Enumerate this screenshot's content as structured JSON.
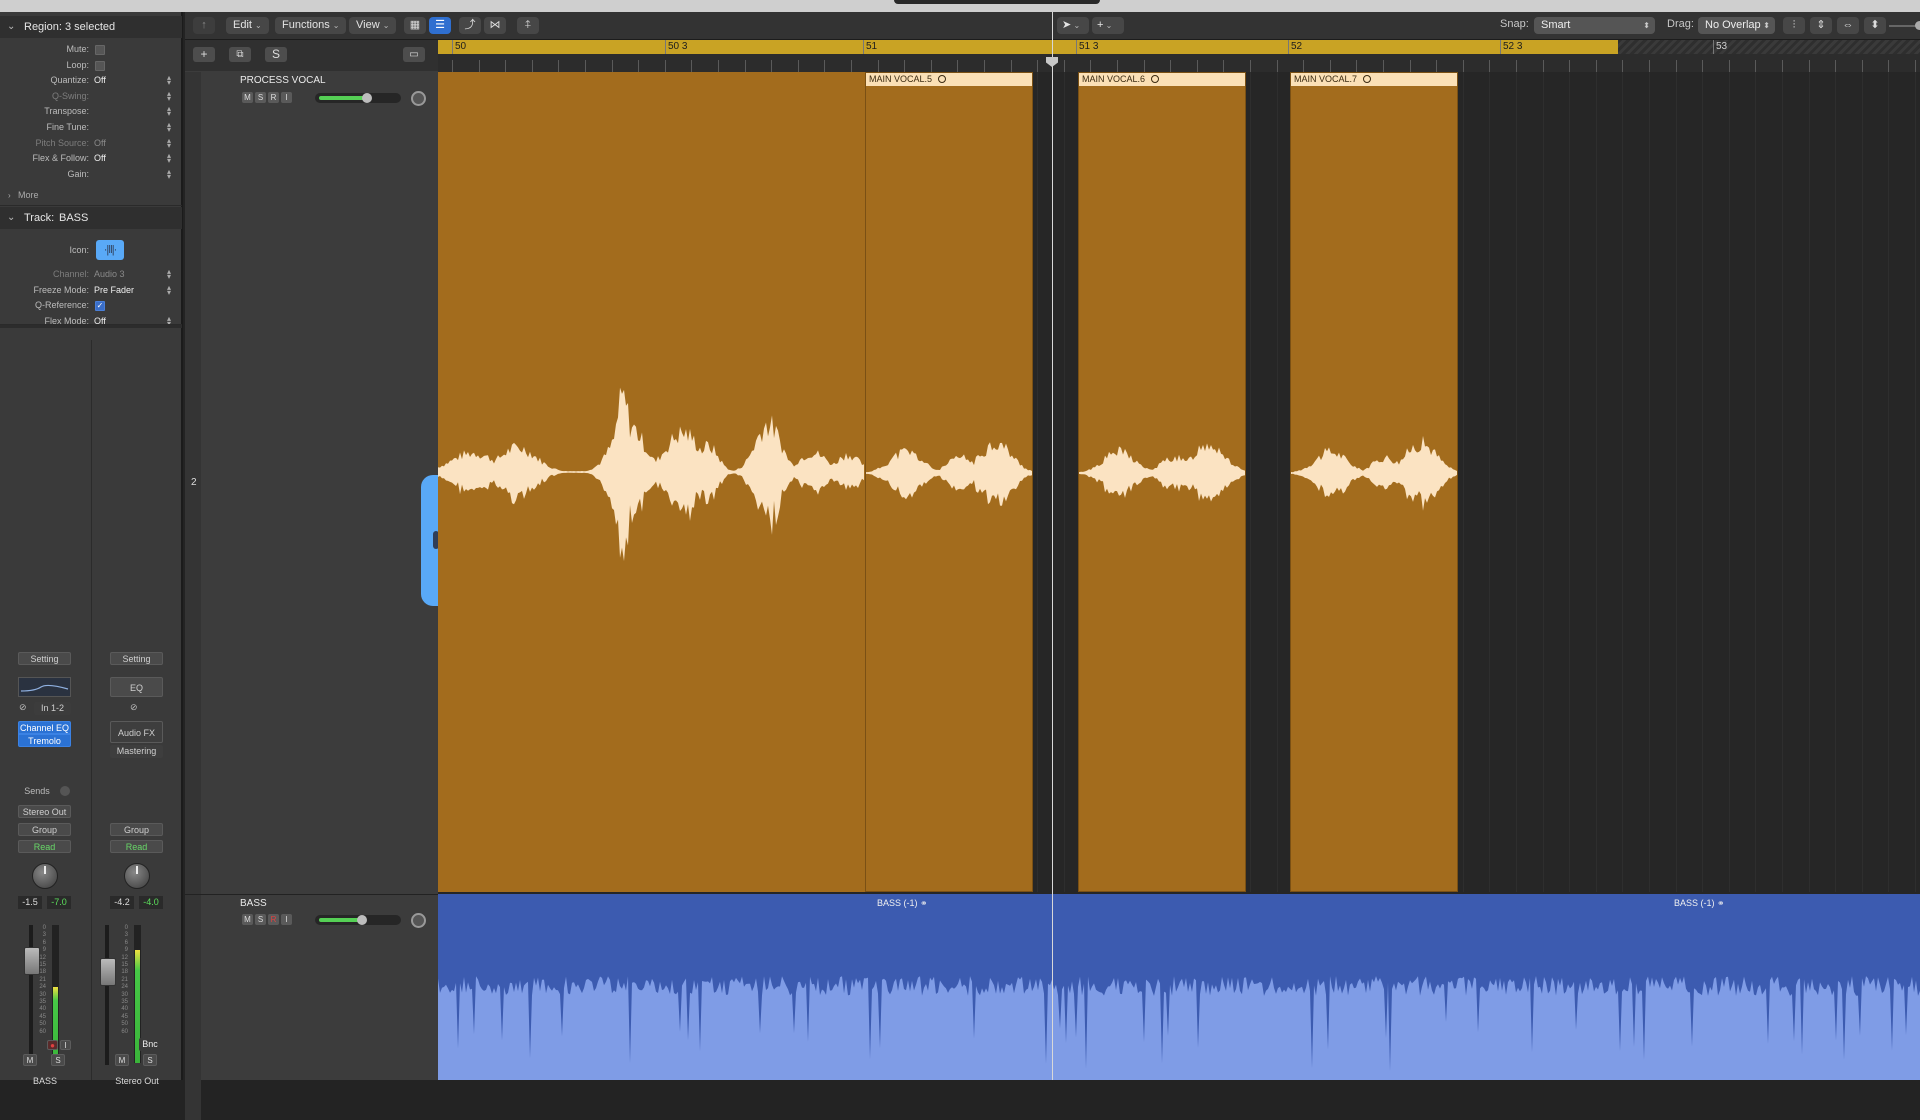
{
  "colors": {
    "region_orange": "#a36c1d",
    "region_header": "#fbe0b6",
    "waveform_light": "#fbe3c2",
    "bass_blue": "#3c5bb0",
    "bass_wave": "#7f9ce6",
    "cycle_yellow": "#c9a324",
    "accent_blue": "#2f6fd0",
    "icon_blue": "#59a9f7"
  },
  "inspector": {
    "region_header": "Region: 3 selected",
    "region_params": [
      {
        "label": "Mute:",
        "type": "check"
      },
      {
        "label": "Loop:",
        "type": "check"
      },
      {
        "label": "Quantize:",
        "value": "Off"
      },
      {
        "label": "Q-Swing:",
        "value": "",
        "dim": true
      },
      {
        "label": "Transpose:",
        "value": ""
      },
      {
        "label": "Fine Tune:",
        "value": ""
      },
      {
        "label": "Pitch Source:",
        "value": "Off",
        "dim": true
      },
      {
        "label": "Flex & Follow:",
        "value": "Off"
      },
      {
        "label": "Gain:",
        "value": ""
      }
    ],
    "more_label": "More",
    "track_header_label": "Track:",
    "track_header_name": "BASS",
    "icon_label": "Icon:",
    "track_params": [
      {
        "label": "Channel:",
        "value": "Audio 3",
        "dim": true
      },
      {
        "label": "Freeze Mode:",
        "value": "Pre Fader"
      },
      {
        "label": "Q-Reference:",
        "type": "checkon"
      },
      {
        "label": "Flex Mode:",
        "value": "Off"
      }
    ]
  },
  "strips": [
    {
      "setting": "Setting",
      "input": "In 1-2",
      "inserts": [
        "Channel EQ",
        "Tremolo"
      ],
      "sends": "Sends",
      "output": "Stereo Out",
      "group": "Group",
      "automation": "Read",
      "vol_left": "-1.5",
      "vol_right": "-7.0",
      "meter_level": 0.55,
      "rec_i": "I",
      "m": "M",
      "s": "S",
      "name": "BASS"
    },
    {
      "setting": "Setting",
      "eq": "EQ",
      "audio_fx": "Audio FX",
      "mastering": "Mastering",
      "group": "Group",
      "automation": "Read",
      "vol_left": "-4.2",
      "vol_right": "-4.0",
      "meter_level": 0.82,
      "bnc": "Bnc",
      "m": "M",
      "s": "S",
      "name": "Stereo Out"
    }
  ],
  "meter_scale": [
    "0",
    "3",
    "6",
    "9",
    "12",
    "15",
    "18",
    "21",
    "24",
    "30",
    "35",
    "40",
    "45",
    "50",
    "60"
  ],
  "toolbar": {
    "edit": "Edit",
    "functions": "Functions",
    "view": "View",
    "snap_label": "Snap:",
    "snap_value": "Smart",
    "drag_label": "Drag:",
    "drag_value": "No Overlap"
  },
  "track_header_tools": {
    "add": "+",
    "dup": "⧉",
    "s": "S"
  },
  "tracks": [
    {
      "number": "2",
      "name": "PROCESS VOCAL",
      "buttons": [
        "M",
        "S",
        "R",
        "I"
      ],
      "volume": 0.62
    },
    {
      "name": "BASS",
      "buttons": [
        "M",
        "S",
        "R",
        "I"
      ],
      "volume": 0.55
    }
  ],
  "ruler": {
    "bars": [
      "50",
      "50 3",
      "51",
      "51 3",
      "52",
      "52 3",
      "53"
    ]
  },
  "regions": {
    "vocal": [
      {
        "name": "MAIN VOCAL.5"
      },
      {
        "name": "MAIN VOCAL.6"
      },
      {
        "name": "MAIN VOCAL.7"
      }
    ],
    "bass": [
      {
        "name": "BASS (-1)"
      },
      {
        "name": "BASS (-1)"
      }
    ]
  }
}
